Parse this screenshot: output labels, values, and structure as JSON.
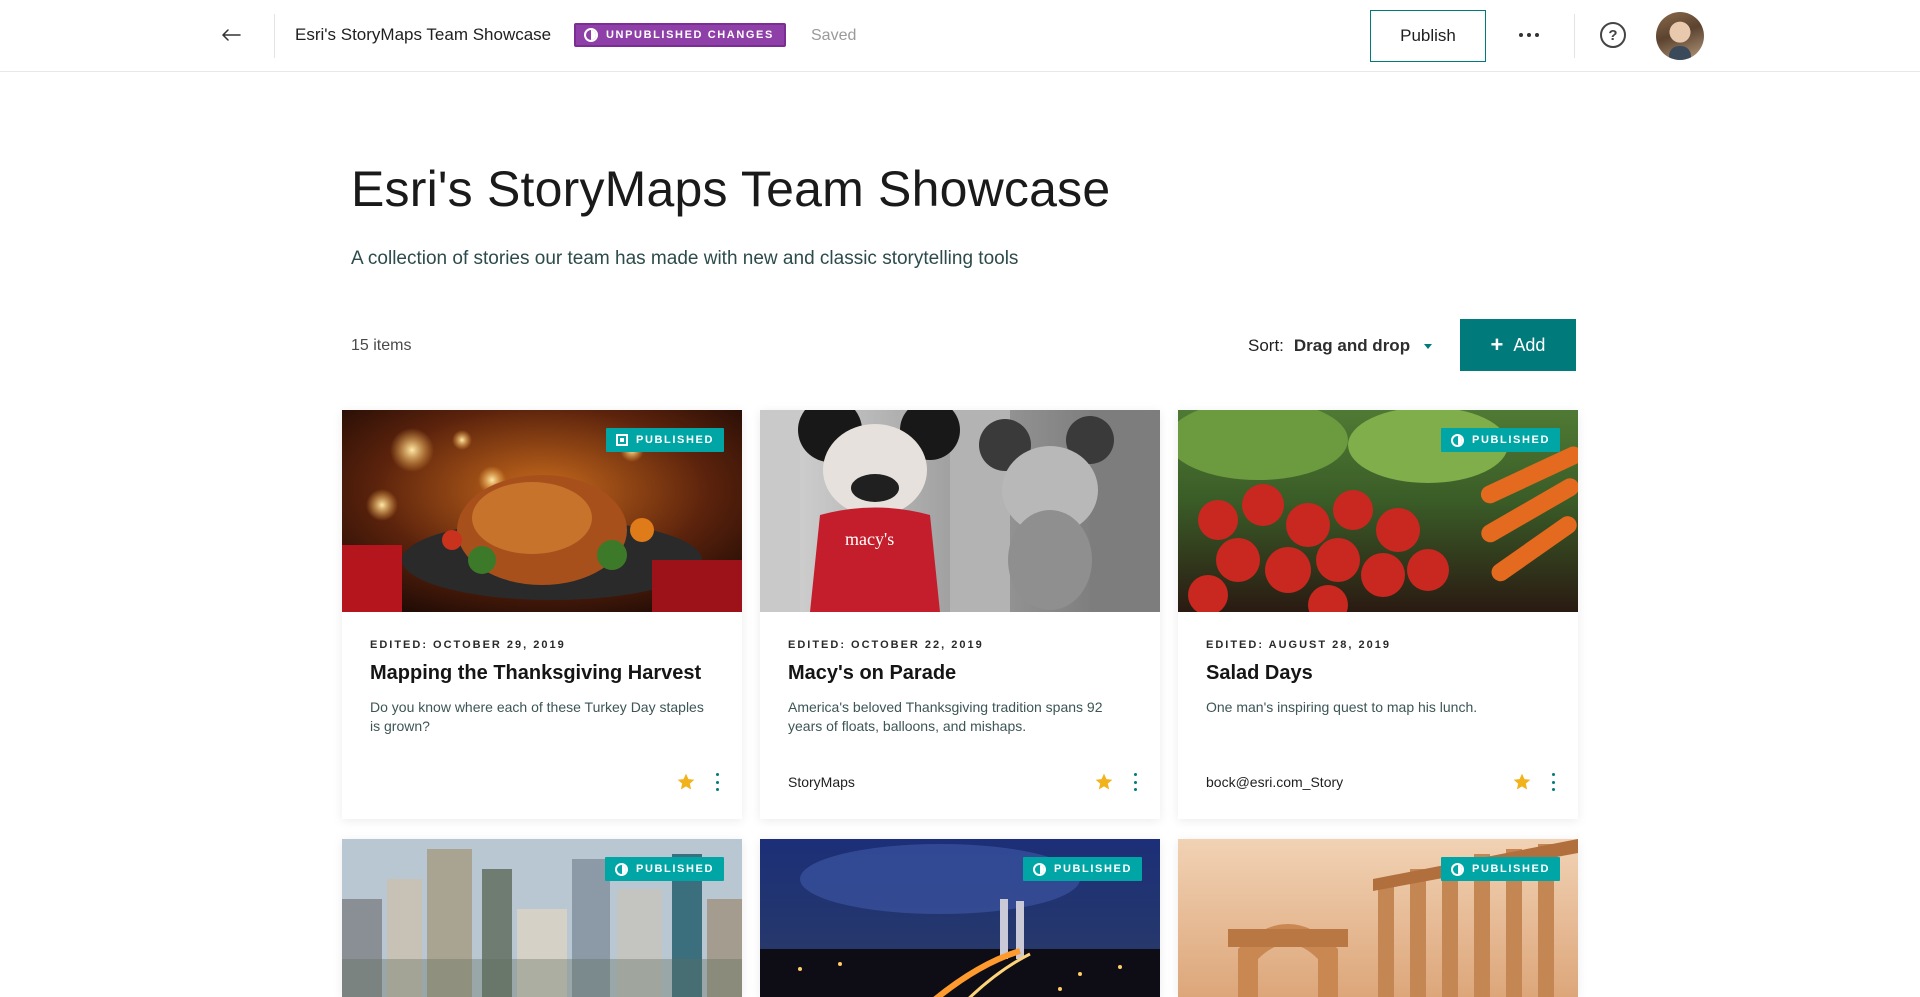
{
  "topbar": {
    "story_title": "Esri's StoryMaps Team Showcase",
    "unpublished_badge": "UNPUBLISHED CHANGES",
    "saved_status": "Saved",
    "publish_label": "Publish",
    "help_symbol": "?"
  },
  "collection": {
    "title": "Esri's StoryMaps Team Showcase",
    "subtitle": "A collection of stories our team has made with new and classic storytelling tools",
    "items_count": "15 items",
    "sort_label": "Sort:",
    "sort_value": "Drag and drop",
    "add_label": "Add"
  },
  "colors": {
    "accent": "#007a7a",
    "unpublished_badge": "#8f3fa8",
    "published_badge": "#00a6a6",
    "star": "#f2b21b"
  },
  "cards": [
    {
      "badge": "PUBLISHED",
      "badge_icon": "grid-icon",
      "edited": "EDITED: OCTOBER 29, 2019",
      "title": "Mapping the Thanksgiving Harvest",
      "description": "Do you know where each of these Turkey Day staples is grown?",
      "author": "",
      "favorited": true
    },
    {
      "badge": "",
      "badge_icon": "",
      "edited": "EDITED: OCTOBER 22, 2019",
      "title": "Macy's on Parade",
      "description": "America's beloved Thanksgiving tradition spans 92 years of floats, balloons, and mishaps.",
      "author": "StoryMaps",
      "favorited": true
    },
    {
      "badge": "PUBLISHED",
      "badge_icon": "half-circle-icon",
      "edited": "EDITED: AUGUST 28, 2019",
      "title": "Salad Days",
      "description": "One man's inspiring quest to map his lunch.",
      "author": "bock@esri.com_Story",
      "favorited": true
    },
    {
      "badge": "PUBLISHED",
      "badge_icon": "half-circle-icon"
    },
    {
      "badge": "PUBLISHED",
      "badge_icon": "half-circle-icon"
    },
    {
      "badge": "PUBLISHED",
      "badge_icon": "half-circle-icon"
    }
  ]
}
